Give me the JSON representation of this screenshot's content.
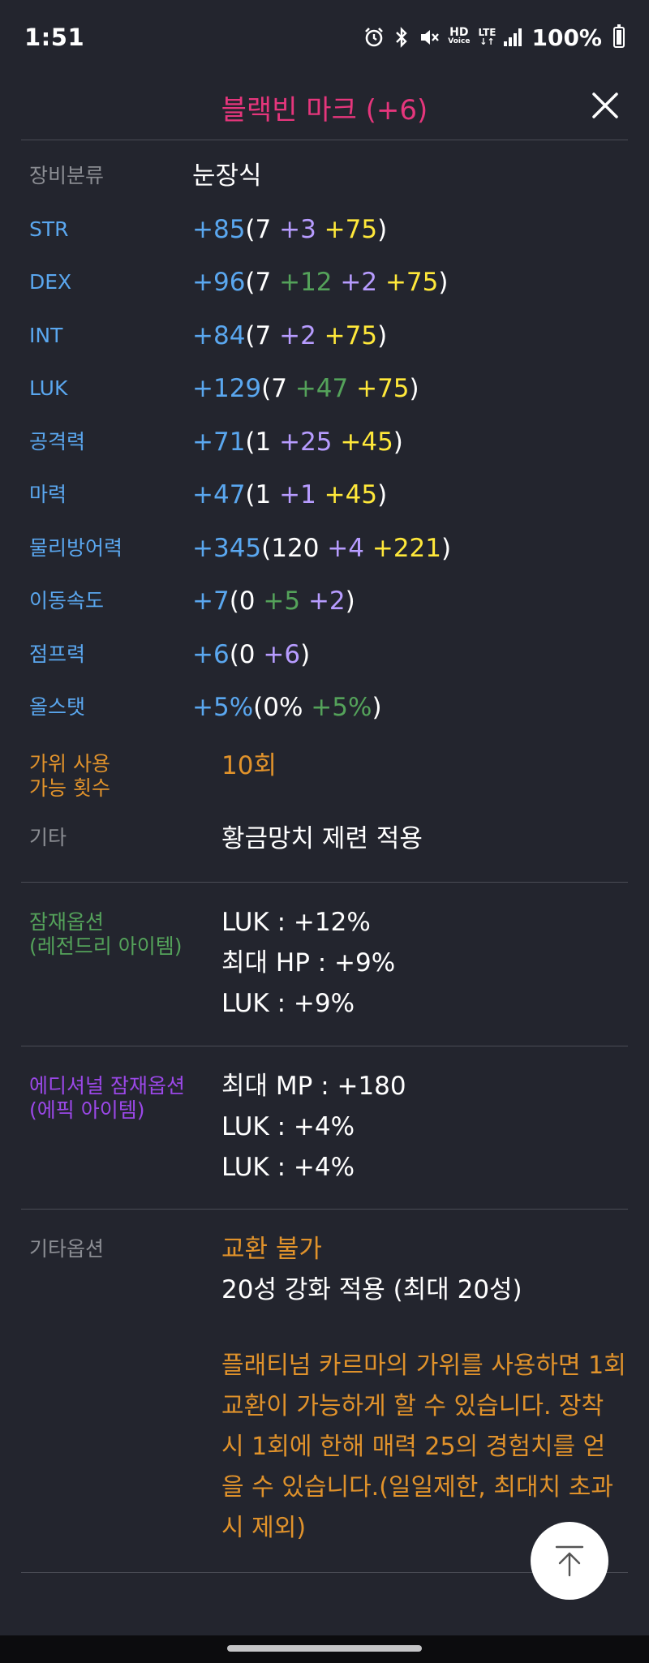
{
  "status_bar": {
    "time": "1:51",
    "hd_top": "HD",
    "hd_bottom": "Voice",
    "lte_top": "LTE",
    "lte_bottom": "↓↑",
    "battery": "100%"
  },
  "header": {
    "title": "블랙빈 마크 (+6)",
    "title_color": "#e5367c"
  },
  "stats": [
    {
      "label": "장비분류",
      "parts": [
        {
          "t": "눈장식",
          "c": "white"
        }
      ]
    },
    {
      "label": "STR",
      "parts": [
        {
          "t": "+85",
          "c": "blue"
        },
        {
          "t": "(7 ",
          "c": "white"
        },
        {
          "t": "+3 ",
          "c": "purple"
        },
        {
          "t": "+75",
          "c": "yellow"
        },
        {
          "t": ")",
          "c": "white"
        }
      ]
    },
    {
      "label": "DEX",
      "parts": [
        {
          "t": "+96",
          "c": "blue"
        },
        {
          "t": "(7 ",
          "c": "white"
        },
        {
          "t": "+12 ",
          "c": "green"
        },
        {
          "t": "+2 ",
          "c": "purple"
        },
        {
          "t": "+75",
          "c": "yellow"
        },
        {
          "t": ")",
          "c": "white"
        }
      ]
    },
    {
      "label": "INT",
      "parts": [
        {
          "t": "+84",
          "c": "blue"
        },
        {
          "t": "(7 ",
          "c": "white"
        },
        {
          "t": "+2 ",
          "c": "purple"
        },
        {
          "t": "+75",
          "c": "yellow"
        },
        {
          "t": ")",
          "c": "white"
        }
      ]
    },
    {
      "label": "LUK",
      "parts": [
        {
          "t": "+129",
          "c": "blue"
        },
        {
          "t": "(7 ",
          "c": "white"
        },
        {
          "t": "+47 ",
          "c": "green"
        },
        {
          "t": "+75",
          "c": "yellow"
        },
        {
          "t": ")",
          "c": "white"
        }
      ]
    },
    {
      "label": "공격력",
      "parts": [
        {
          "t": "+71",
          "c": "blue"
        },
        {
          "t": "(1 ",
          "c": "white"
        },
        {
          "t": "+25 ",
          "c": "purple"
        },
        {
          "t": "+45",
          "c": "yellow"
        },
        {
          "t": ")",
          "c": "white"
        }
      ]
    },
    {
      "label": "마력",
      "parts": [
        {
          "t": "+47",
          "c": "blue"
        },
        {
          "t": "(1 ",
          "c": "white"
        },
        {
          "t": "+1 ",
          "c": "purple"
        },
        {
          "t": "+45",
          "c": "yellow"
        },
        {
          "t": ")",
          "c": "white"
        }
      ]
    },
    {
      "label": "물리방어력",
      "parts": [
        {
          "t": "+345",
          "c": "blue"
        },
        {
          "t": "(120 ",
          "c": "white"
        },
        {
          "t": "+4 ",
          "c": "purple"
        },
        {
          "t": "+221",
          "c": "yellow"
        },
        {
          "t": ")",
          "c": "white"
        }
      ]
    },
    {
      "label": "이동속도",
      "parts": [
        {
          "t": "+7",
          "c": "blue"
        },
        {
          "t": "(0 ",
          "c": "white"
        },
        {
          "t": "+5 ",
          "c": "green"
        },
        {
          "t": "+2",
          "c": "purple"
        },
        {
          "t": ")",
          "c": "white"
        }
      ]
    },
    {
      "label": "점프력",
      "parts": [
        {
          "t": "+6",
          "c": "blue"
        },
        {
          "t": "(0 ",
          "c": "white"
        },
        {
          "t": "+6",
          "c": "purple"
        },
        {
          "t": ")",
          "c": "white"
        }
      ]
    },
    {
      "label": "올스탯",
      "parts": [
        {
          "t": "+5%",
          "c": "blue"
        },
        {
          "t": "(0% ",
          "c": "white"
        },
        {
          "t": "+5%",
          "c": "green"
        },
        {
          "t": ")",
          "c": "white"
        }
      ]
    }
  ],
  "scissors": {
    "label_line1": "가위 사용",
    "label_line2": "가능 횟수",
    "value": "10회"
  },
  "etc": {
    "label": "기타",
    "value": "황금망치 제련 적용"
  },
  "potential": {
    "label_line1": "잠재옵션",
    "label_line2": "(레전드리 아이템)",
    "lines": [
      "LUK : +12%",
      "최대 HP : +9%",
      "LUK : +9%"
    ]
  },
  "additional": {
    "label_line1": "에디셔널 잠재옵션",
    "label_line2": "(에픽 아이템)",
    "lines": [
      "최대 MP : +180",
      "LUK : +4%",
      "LUK : +4%"
    ]
  },
  "other": {
    "label": "기타옵션",
    "trade": "교환 불가",
    "star": "20성 강화 적용 (최대 20성)",
    "note": "플래티넘 카르마의 가위를 사용하면 1회 교환이 가능하게 할 수 있습니다. 장착 시 1회에 한해 매력 25의 경험치를 얻을 수 있습니다.(일일제한, 최대치 초과 시 제외)"
  },
  "colors": {
    "blue": "#5aa7ef",
    "green": "#54a25a",
    "purple": "#b79cff",
    "yellow": "#ffe83a",
    "orange": "#e0922b",
    "background": "#23252e"
  },
  "icons": {
    "close": "close-icon",
    "scroll_top": "arrow-up-to-top-icon",
    "alarm": "alarm-icon",
    "bluetooth": "bluetooth-icon",
    "mute": "mute-icon"
  }
}
